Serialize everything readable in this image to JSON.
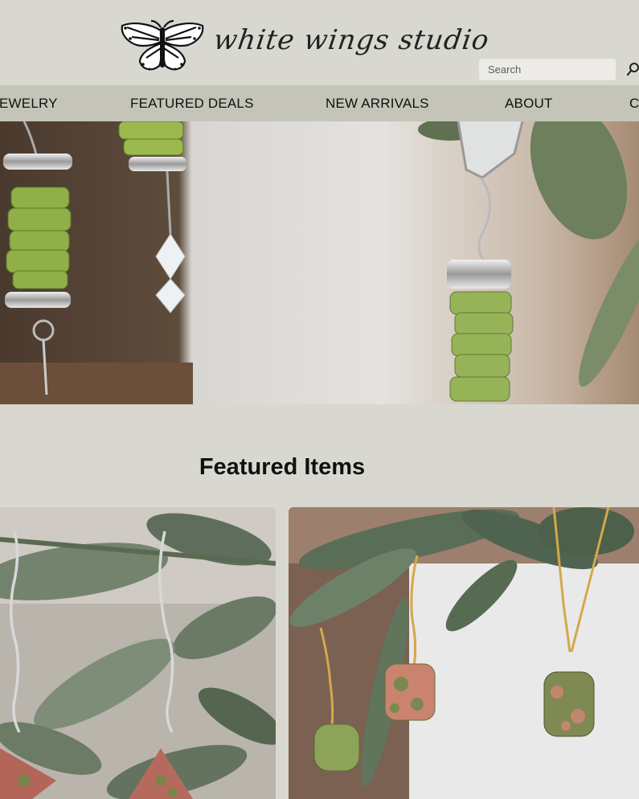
{
  "header": {
    "brand": "white wings studio",
    "search_placeholder": "Search"
  },
  "nav": {
    "items": [
      "JEWELRY",
      "FEATURED DEALS",
      "NEW ARRIVALS",
      "ABOUT",
      "C"
    ],
    "visible_items": [
      "EWELRY",
      "FEATURED DEALS",
      "NEW ARRIVALS",
      "ABOUT",
      "C"
    ]
  },
  "hero": {
    "image": "green peridot chip bead earrings hanging on plant"
  },
  "featured": {
    "title": "Featured Items",
    "items": [
      {
        "image": "unakite triangle silver earrings on leaves"
      },
      {
        "image": "unakite and green bead gold earrings and necklace"
      }
    ]
  },
  "colors": {
    "page_bg": "#d8d8d0",
    "nav_bg": "#c4c5b8",
    "search_bg": "#ecebe7",
    "text": "#111111"
  }
}
